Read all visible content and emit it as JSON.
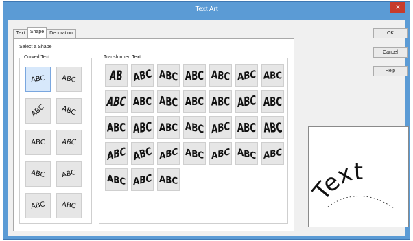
{
  "window": {
    "title": "Text Art",
    "close_glyph": "×"
  },
  "tabs": [
    {
      "label": "Text",
      "active": false
    },
    {
      "label": "Shape",
      "active": true
    },
    {
      "label": "Decoration",
      "active": false
    }
  ],
  "panel": {
    "select_label": "Select a Shape",
    "curved_label": "Curved Text",
    "transformed_label": "Transformed Text"
  },
  "curved": [
    "ABC",
    "ABC",
    "ABC",
    "ABC",
    "ABC",
    "ABC",
    "ABC",
    "ABC",
    "ABC",
    "ABC"
  ],
  "transformed": [
    "AB",
    "ABC",
    "ABC",
    "ABC",
    "ABC",
    "ABC",
    "ABC",
    "ABC",
    "ABC",
    "ABC",
    "ABC",
    "ABC",
    "ABC",
    "ABC",
    "ABC",
    "ABC",
    "ABC",
    "ABC",
    "ABC",
    "ABC",
    "ABC",
    "ABC",
    "ABC",
    "ABC",
    "ABC",
    "ABC",
    "ABC",
    "ABC",
    "ABC",
    "ABC",
    "ABC"
  ],
  "buttons": {
    "ok": "OK",
    "cancel": "Cancel",
    "help": "Help"
  },
  "preview": {
    "text": "Text"
  }
}
